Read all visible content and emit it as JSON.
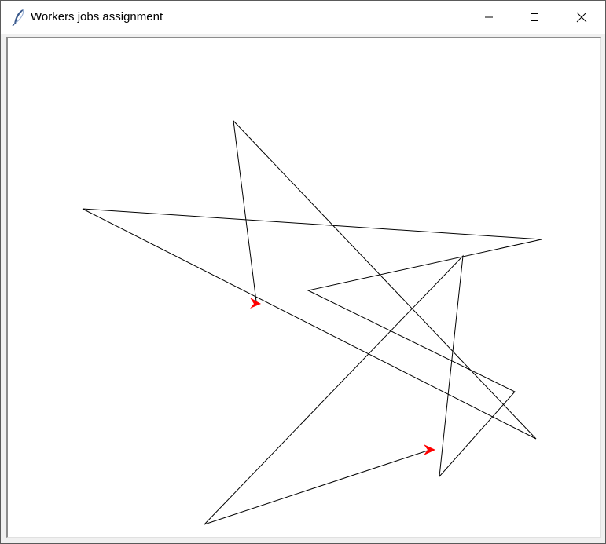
{
  "window": {
    "title": "Workers jobs assignment",
    "controls": {
      "minimize_icon": "minimize-icon",
      "maximize_icon": "maximize-icon",
      "close_icon": "close-icon"
    }
  },
  "canvas": {
    "background": "#ffffff",
    "line_color": "#000000",
    "marker_color": "#ff0000"
  }
}
